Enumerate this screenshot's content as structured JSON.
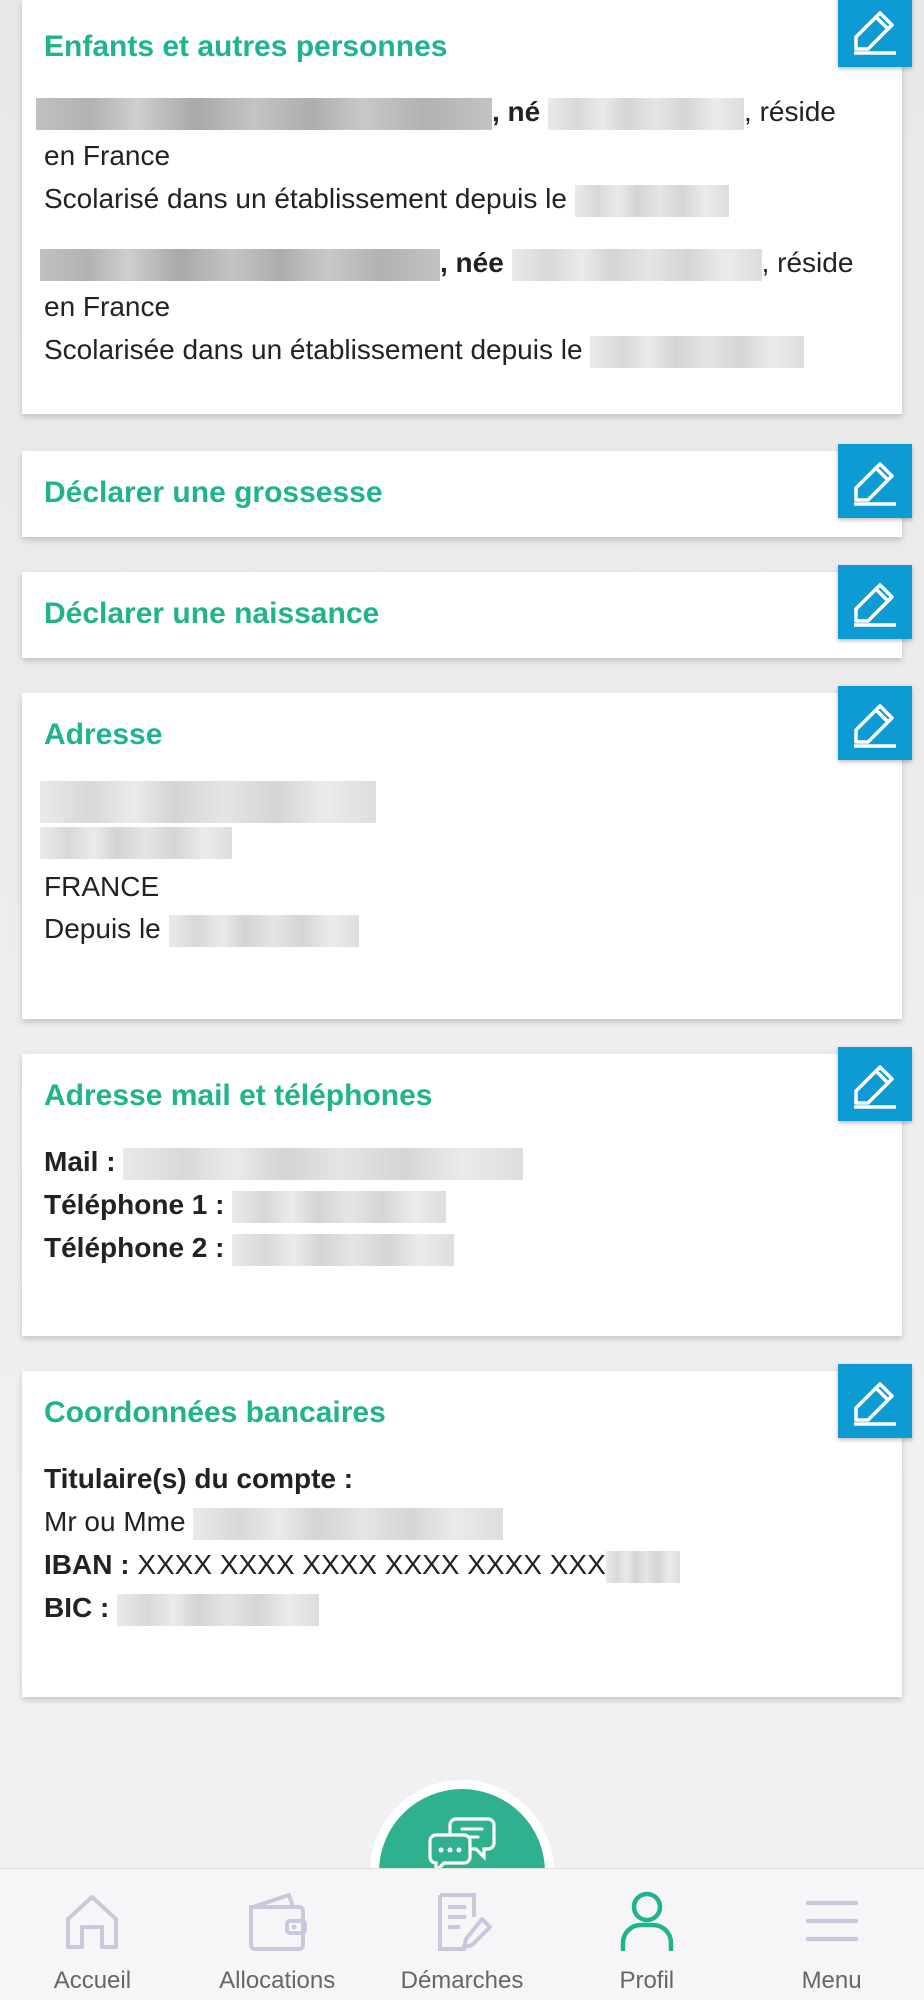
{
  "cards": {
    "enfants": {
      "title": "Enfants et autres personnes",
      "child1": {
        "ne": ", né",
        "reside": ", réside",
        "en_france": "en France",
        "scol": "Scolarisé dans un établissement depuis le"
      },
      "child2": {
        "nee": ", née",
        "reside": ", réside",
        "en_france": "en France",
        "scol": "Scolarisée dans un établissement depuis le"
      }
    },
    "grossesse": {
      "title": "Déclarer une grossesse"
    },
    "naissance": {
      "title": "Déclarer une naissance"
    },
    "adresse": {
      "title": "Adresse",
      "country": "FRANCE",
      "depuis": "Depuis le"
    },
    "contact": {
      "title": "Adresse mail et téléphones",
      "mail_label": "Mail :",
      "tel1_label": "Téléphone 1 :",
      "tel2_label": "Téléphone 2 :"
    },
    "banque": {
      "title": "Coordonnées bancaires",
      "titulaire_label": "Titulaire(s) du compte :",
      "titulaire_prefix": "Mr ou Mme",
      "iban_label": "IBAN :",
      "iban_value": "XXXX XXXX XXXX XXXX XXXX XXX",
      "bic_label": "BIC :"
    }
  },
  "nav": {
    "items": [
      {
        "label": "Accueil",
        "icon": "home-icon"
      },
      {
        "label": "Allocations",
        "icon": "wallet-icon"
      },
      {
        "label": "Démarches",
        "icon": "document-edit-icon"
      },
      {
        "label": "Profil",
        "icon": "user-icon",
        "active": true
      },
      {
        "label": "Menu",
        "icon": "hamburger-icon"
      }
    ]
  },
  "colors": {
    "accent": "#1fb38e",
    "edit_button": "#0e9bd4",
    "chat_fab": "#2fb08f",
    "nav_active": "#1fb38e",
    "nav_inactive": "#c9c9de"
  }
}
